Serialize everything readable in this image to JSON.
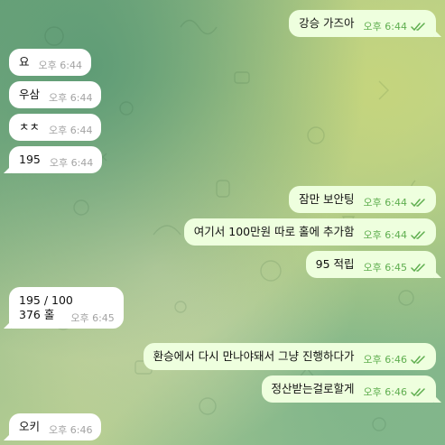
{
  "messages": [
    {
      "side": "out",
      "text": "강승 가즈아",
      "time": "오후 6:44",
      "read": true
    },
    {
      "side": "in",
      "text": "요",
      "time": "오후 6:44"
    },
    {
      "side": "in",
      "text": "우삼",
      "time": "오후 6:44"
    },
    {
      "side": "in",
      "text": "ㅊㅊ",
      "time": "오후 6:44"
    },
    {
      "side": "in",
      "text": "195",
      "time": "오후 6:44"
    },
    {
      "side": "out",
      "text": "잠만 보안팅",
      "time": "오후 6:44",
      "read": true
    },
    {
      "side": "out",
      "text": "여기서 100만원 따로 홀에 추가함",
      "time": "오후 6:44",
      "read": true
    },
    {
      "side": "out",
      "text": "95 적립",
      "time": "오후 6:45",
      "read": true
    },
    {
      "side": "in",
      "lines": [
        "195 / 100",
        "376 홀"
      ],
      "time": "오후 6:45"
    },
    {
      "side": "out",
      "text": "환승에서 다시 만나야돼서 그냥 진행하다가",
      "time": "오후 6:46",
      "read": true
    },
    {
      "side": "out",
      "text": "정산받는걸로할게",
      "time": "오후 6:46",
      "read": true
    },
    {
      "side": "in",
      "text": "오키",
      "time": "오후 6:46"
    }
  ],
  "colors": {
    "incoming_bubble": "#ffffff",
    "outgoing_bubble": "#eeffde",
    "outgoing_meta": "#5fae4f",
    "incoming_meta": "#a3a3a3"
  }
}
